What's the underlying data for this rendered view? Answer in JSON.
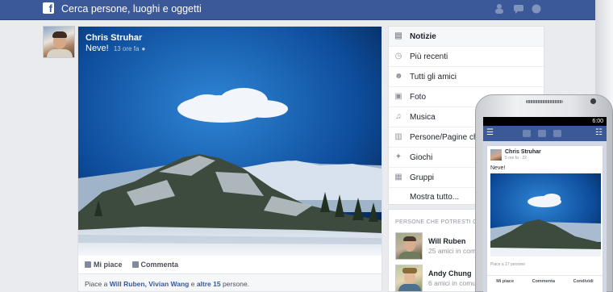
{
  "topbar": {
    "logo": "f",
    "search_placeholder": "Cerca persone, luoghi e oggetti",
    "icons": [
      "friends-icon",
      "messages-icon",
      "notifications-icon"
    ]
  },
  "post": {
    "author": "Chris Struhar",
    "text": "Neve!",
    "time": "13 ore fa",
    "like_label": "Mi piace",
    "comment_label": "Commenta",
    "likes_prefix": "Piace a ",
    "likes_names": "Will Ruben, Vivian Wang",
    "likes_mid": " e ",
    "likes_others": "altre 15",
    "likes_suffix": " persone."
  },
  "menu": {
    "items": [
      {
        "label": "Notizie",
        "icon": "news-icon"
      },
      {
        "label": "Più recenti",
        "icon": "clock-icon"
      },
      {
        "label": "Tutti gli amici",
        "icon": "friends-icon"
      },
      {
        "label": "Foto",
        "icon": "photo-icon"
      },
      {
        "label": "Musica",
        "icon": "music-icon"
      },
      {
        "label": "Persone/Pagine che",
        "icon": "pages-icon"
      },
      {
        "label": "Giochi",
        "icon": "games-icon"
      },
      {
        "label": "Gruppi",
        "icon": "groups-icon"
      },
      {
        "label": "Mostra tutto...",
        "icon": ""
      }
    ]
  },
  "pymk": {
    "title": "PERSONE CHE POTRESTI C",
    "people": [
      {
        "name": "Will Ruben",
        "mutual": "25 amici in comune"
      },
      {
        "name": "Andy Chung",
        "mutual": "6 amici in comu"
      }
    ]
  },
  "phone": {
    "status_time": "6:00",
    "author": "Chris Struhar",
    "time": "5 ore fa · 22",
    "text": "Neve!",
    "likes": "Piace a 17 persone",
    "actions": [
      "Mi piace",
      "Commenta",
      "Condividi"
    ]
  },
  "colors": {
    "brand": "#3b5998",
    "background": "#e9ebee"
  }
}
